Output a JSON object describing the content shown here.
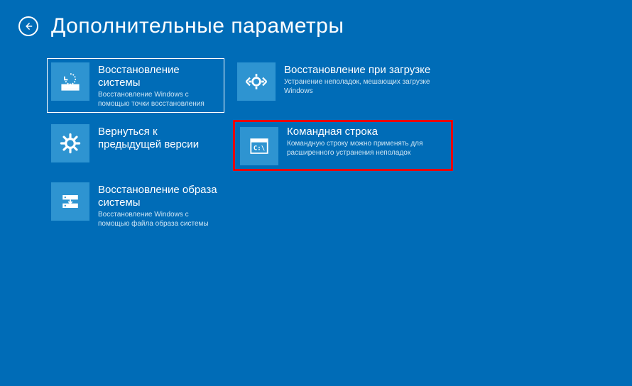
{
  "header": {
    "title": "Дополнительные параметры"
  },
  "tiles": {
    "system_restore": {
      "title": "Восстановление системы",
      "desc": "Восстановление Windows с помощью точки восстановления"
    },
    "startup_repair": {
      "title": "Восстановление при загрузке",
      "desc": "Устранение неполадок, мешающих загрузке Windows"
    },
    "go_back": {
      "title": "Вернуться к предыдущей версии",
      "desc": ""
    },
    "command_prompt": {
      "title": "Командная строка",
      "desc": "Командную строку можно применять для расширенного устранения неполадок"
    },
    "image_recovery": {
      "title": "Восстановление образа системы",
      "desc": "Восстановление Windows с помощью файла образа системы"
    }
  }
}
